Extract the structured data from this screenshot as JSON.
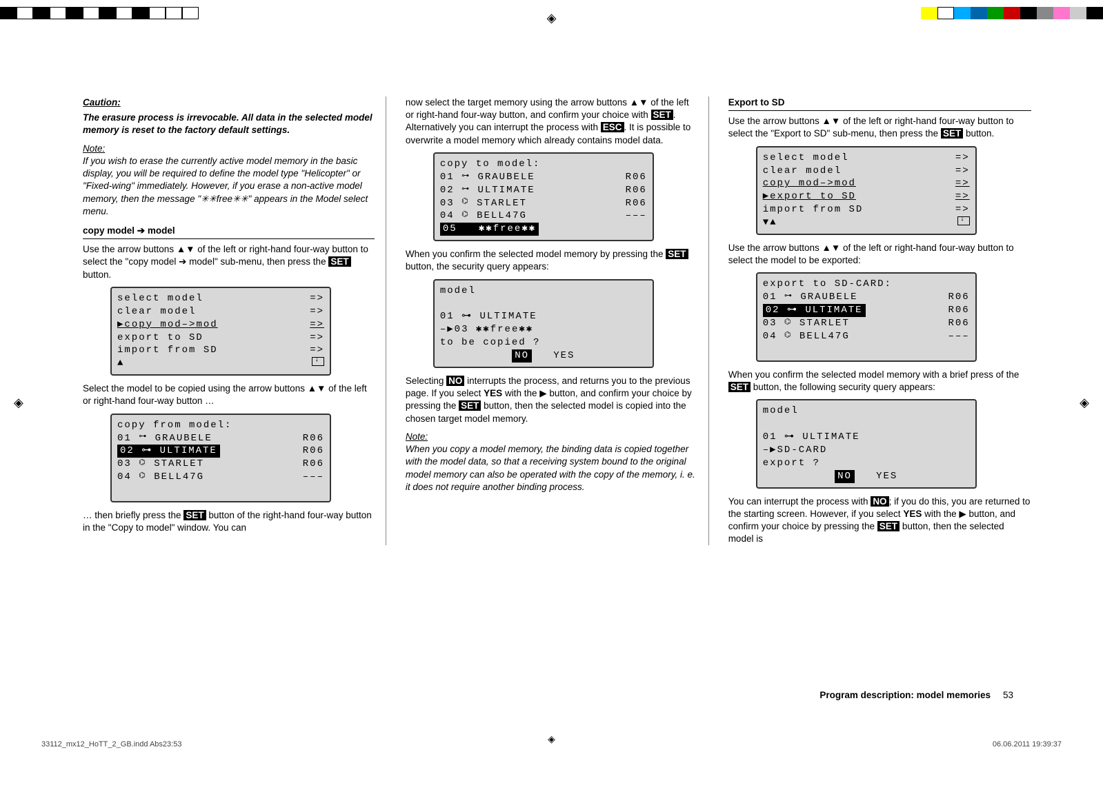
{
  "caution": {
    "title": "Caution:",
    "body": "The erasure process is irrevocable. All data in the selected model memory is reset to the factory default settings."
  },
  "note1": {
    "title": "Note:",
    "body": "If you wish to erase the currently active model memory in the basic display, you will be required to define the model type \"Helicopter\" or \"Fixed-wing\" immediately. However, if you erase a non-active model memory, then the message \"✳✳free✳✳\" appears in the Model select menu."
  },
  "heading_copy": "copy model ➔ model",
  "copy_intro_a": "Use the arrow buttons ▲▼ of the left or right-hand four-way button to select the \"copy model ➔ model\" sub-menu, then press the ",
  "copy_intro_set": "SET",
  "copy_intro_b": " button.",
  "menu1": {
    "r1": {
      "label": "select model",
      "arrow": "=>"
    },
    "r2": {
      "label": "clear model",
      "arrow": "=>"
    },
    "r3": {
      "label": "▶copy mod–>mod",
      "arrow": "=>"
    },
    "r4": {
      "label": "export to SD",
      "arrow": "=>"
    },
    "r5": {
      "label": "import from SD",
      "arrow": "=>"
    },
    "scroll": "▲"
  },
  "copy_select_a": "Select the model to be copied using the arrow buttons ▲▼ of the left or right-hand four-way button …",
  "menu2": {
    "title": "copy from model:",
    "r1": {
      "num": "01",
      "name": "GRAUBELE",
      "rx": "R06"
    },
    "r2": {
      "num": "02",
      "name": "ULTIMATE",
      "rx": "R06"
    },
    "r3": {
      "num": "03",
      "name": "STARLET",
      "rx": "R06"
    },
    "r4": {
      "num": "04",
      "name": "BELL47G",
      "rx": "–––"
    }
  },
  "copy_then_a": "… then briefly press the ",
  "copy_then_set": "SET",
  "copy_then_b": " button of the right-hand four-way button in the \"Copy to model\" window. You can ",
  "col2_top_a": "now select the target memory using the arrow buttons ▲▼ of the left or right-hand four-way button, and confirm your choice with ",
  "col2_top_set": "SET",
  "col2_top_b": ". Alternatively you can interrupt the process with ",
  "col2_top_esc": "ESC",
  "col2_top_c": ". It is possible to overwrite a model memory which already contains model data.",
  "menu3": {
    "title": "copy to model:",
    "r1": {
      "num": "01",
      "name": "GRAUBELE",
      "rx": "R06"
    },
    "r2": {
      "num": "02",
      "name": "ULTIMATE",
      "rx": "R06"
    },
    "r3": {
      "num": "03",
      "name": "STARLET",
      "rx": "R06"
    },
    "r4": {
      "num": "04",
      "name": "BELL47G",
      "rx": "–––"
    },
    "r5": {
      "num": "05",
      "name": "✱✱free✱✱"
    }
  },
  "confirm_a": "When you confirm the selected model memory by pressing the ",
  "confirm_set": "SET",
  "confirm_b": " button, the security query appears:",
  "dialog1": {
    "title": "model",
    "line1": "  01  ⊶  ULTIMATE",
    "line2": " –▶03     ✱✱free✱✱",
    "line3": "to be copied ?",
    "no": "NO",
    "yes": "YES"
  },
  "selecting_a": "Selecting ",
  "selecting_no": "NO",
  "selecting_b": " interrupts the process, and returns you to the previous page. If you select ",
  "selecting_yes": "YES",
  "selecting_c": " with the ▶ button, and confirm your choice by pressing the ",
  "selecting_set": "SET",
  "selecting_d": " button, then the selected model is copied into the chosen target model memory.",
  "note2": {
    "title": "Note:",
    "body": "When you copy a model memory, the binding data is copied together with the model data, so that a receiving system bound to the original model memory can also be operated with the copy of the memory, i. e. it does not require another binding process."
  },
  "export_heading": "Export to SD",
  "export_a": "Use the arrow buttons ▲▼ of the left or right-hand four-way button to select the \"Export to SD\" sub-menu, then press the ",
  "export_set": "SET",
  "export_b": " button.",
  "menu4": {
    "r1": {
      "label": "select model",
      "arrow": "=>"
    },
    "r2": {
      "label": "clear model",
      "arrow": "=>"
    },
    "r3": {
      "label": "copy mod–>mod",
      "arrow": "=>"
    },
    "r4": {
      "label": "▶export to SD",
      "arrow": "=>"
    },
    "r5": {
      "label": "import from SD",
      "arrow": "=>"
    },
    "scroll": "▼▲"
  },
  "export_sel": "Use the arrow buttons ▲▼ of the left or right-hand four-way button to select the model to be exported:",
  "menu5": {
    "title": "export to SD-CARD:",
    "r1": {
      "num": "01",
      "name": "GRAUBELE",
      "rx": "R06"
    },
    "r2": {
      "num": "02",
      "name": "ULTIMATE",
      "rx": "R06"
    },
    "r3": {
      "num": "03",
      "name": "STARLET",
      "rx": "R06"
    },
    "r4": {
      "num": "04",
      "name": "BELL47G",
      "rx": "–––"
    }
  },
  "export_confirm_a": "When you confirm the selected model memory with a brief press of the ",
  "export_confirm_set": "SET",
  "export_confirm_b": " button, the following security query appears:",
  "dialog2": {
    "title": "model",
    "line1": "  01  ⊶  ULTIMATE",
    "line2": " –▶SD-CARD",
    "line3": "export ?",
    "no": "NO",
    "yes": "YES"
  },
  "interrupt_a": "You can interrupt the process with ",
  "interrupt_no": "NO",
  "interrupt_b": "; if you do this, you are returned to the starting screen. However, if you select ",
  "interrupt_yes": "YES",
  "interrupt_c": " with the ▶ button, and confirm your choice by pressing the ",
  "interrupt_set": "SET",
  "interrupt_d": " button, then the selected model is ",
  "footer": {
    "desc": "Program description: model memories",
    "page": "53"
  },
  "bottom": {
    "file": "33112_mx12_HoTT_2_GB.indd   Abs23:53",
    "date": "06.06.2011   19:39:37"
  }
}
